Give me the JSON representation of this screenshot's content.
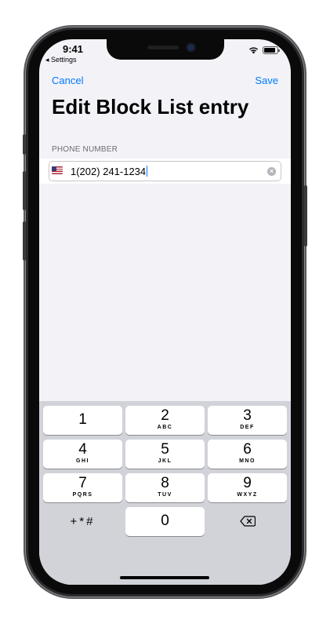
{
  "status_bar": {
    "time": "9:41",
    "back_label": "◂ Settings"
  },
  "nav": {
    "cancel_label": "Cancel",
    "save_label": "Save"
  },
  "page": {
    "title": "Edit Block List entry"
  },
  "form": {
    "section_label": "PHONE NUMBER",
    "phone_value": "1(202) 241-1234",
    "clear_glyph": "×"
  },
  "keypad": {
    "keys": [
      {
        "digit": "1",
        "letters": ""
      },
      {
        "digit": "2",
        "letters": "ABC"
      },
      {
        "digit": "3",
        "letters": "DEF"
      },
      {
        "digit": "4",
        "letters": "GHI"
      },
      {
        "digit": "5",
        "letters": "JKL"
      },
      {
        "digit": "6",
        "letters": "MNO"
      },
      {
        "digit": "7",
        "letters": "PQRS"
      },
      {
        "digit": "8",
        "letters": "TUV"
      },
      {
        "digit": "9",
        "letters": "WXYZ"
      },
      {
        "digit": "+*#",
        "letters": ""
      },
      {
        "digit": "0",
        "letters": ""
      }
    ]
  },
  "colors": {
    "accent": "#007aff",
    "background": "#f2f2f7",
    "keyboard": "#d1d3d9"
  },
  "icons": [
    "wifi-icon",
    "battery-icon",
    "us-flag-icon",
    "clear-icon",
    "backspace-icon"
  ]
}
